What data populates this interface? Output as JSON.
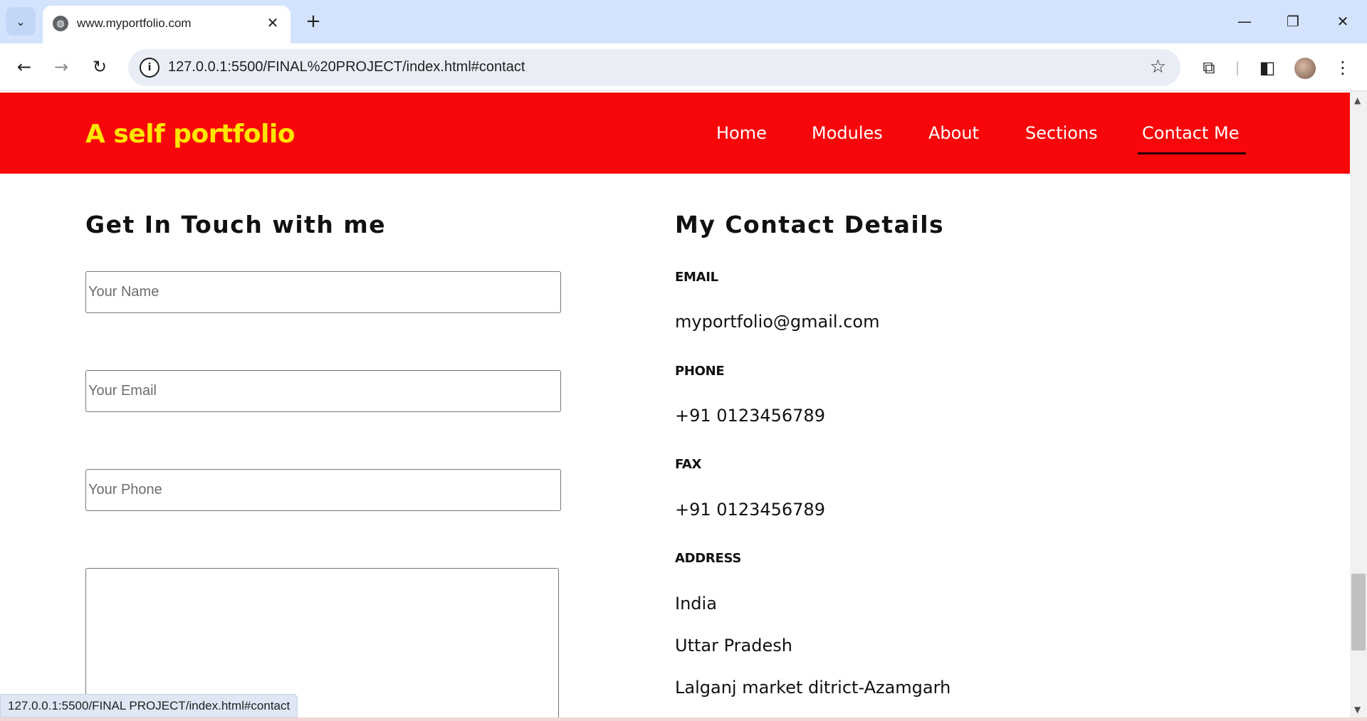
{
  "browser": {
    "tab_title": "www.myportfolio.com",
    "url": "127.0.0.1:5500/FINAL%20PROJECT/index.html#contact",
    "status_url": "127.0.0.1:5500/FINAL PROJECT/index.html#contact",
    "icons": {
      "tab_search": "chevron-down-icon",
      "favicon": "globe-icon",
      "close_tab": "close-icon",
      "new_tab": "plus-icon",
      "back": "back-arrow-icon",
      "forward": "forward-arrow-icon",
      "reload": "reload-icon",
      "site_info": "info-icon",
      "bookmark": "star-icon",
      "extensions": "puzzle-icon",
      "side_panel": "side-panel-icon",
      "menu": "kebab-menu-icon"
    }
  },
  "site": {
    "logo": "A self portfolio",
    "nav": [
      {
        "label": "Home"
      },
      {
        "label": "Modules"
      },
      {
        "label": "About"
      },
      {
        "label": "Sections"
      },
      {
        "label": "Contact Me",
        "active": true
      }
    ],
    "colors": {
      "header_bg": "#f7070a",
      "logo": "#ffe600",
      "nav_text": "#ffffff"
    }
  },
  "form": {
    "title": "Get In Touch with me",
    "name_placeholder": "Your Name",
    "email_placeholder": "Your Email",
    "phone_placeholder": "Your Phone"
  },
  "contact": {
    "title": "My Contact Details",
    "email_label": "EMAIL",
    "email": "myportfolio@gmail.com",
    "phone_label": "PHONE",
    "phone": "+91 0123456789",
    "fax_label": "FAX",
    "fax": "+91 0123456789",
    "address_label": "ADDRESS",
    "address_lines": [
      "India",
      "Uttar Pradesh",
      "Lalganj market ditrict-Azamgarh"
    ]
  }
}
